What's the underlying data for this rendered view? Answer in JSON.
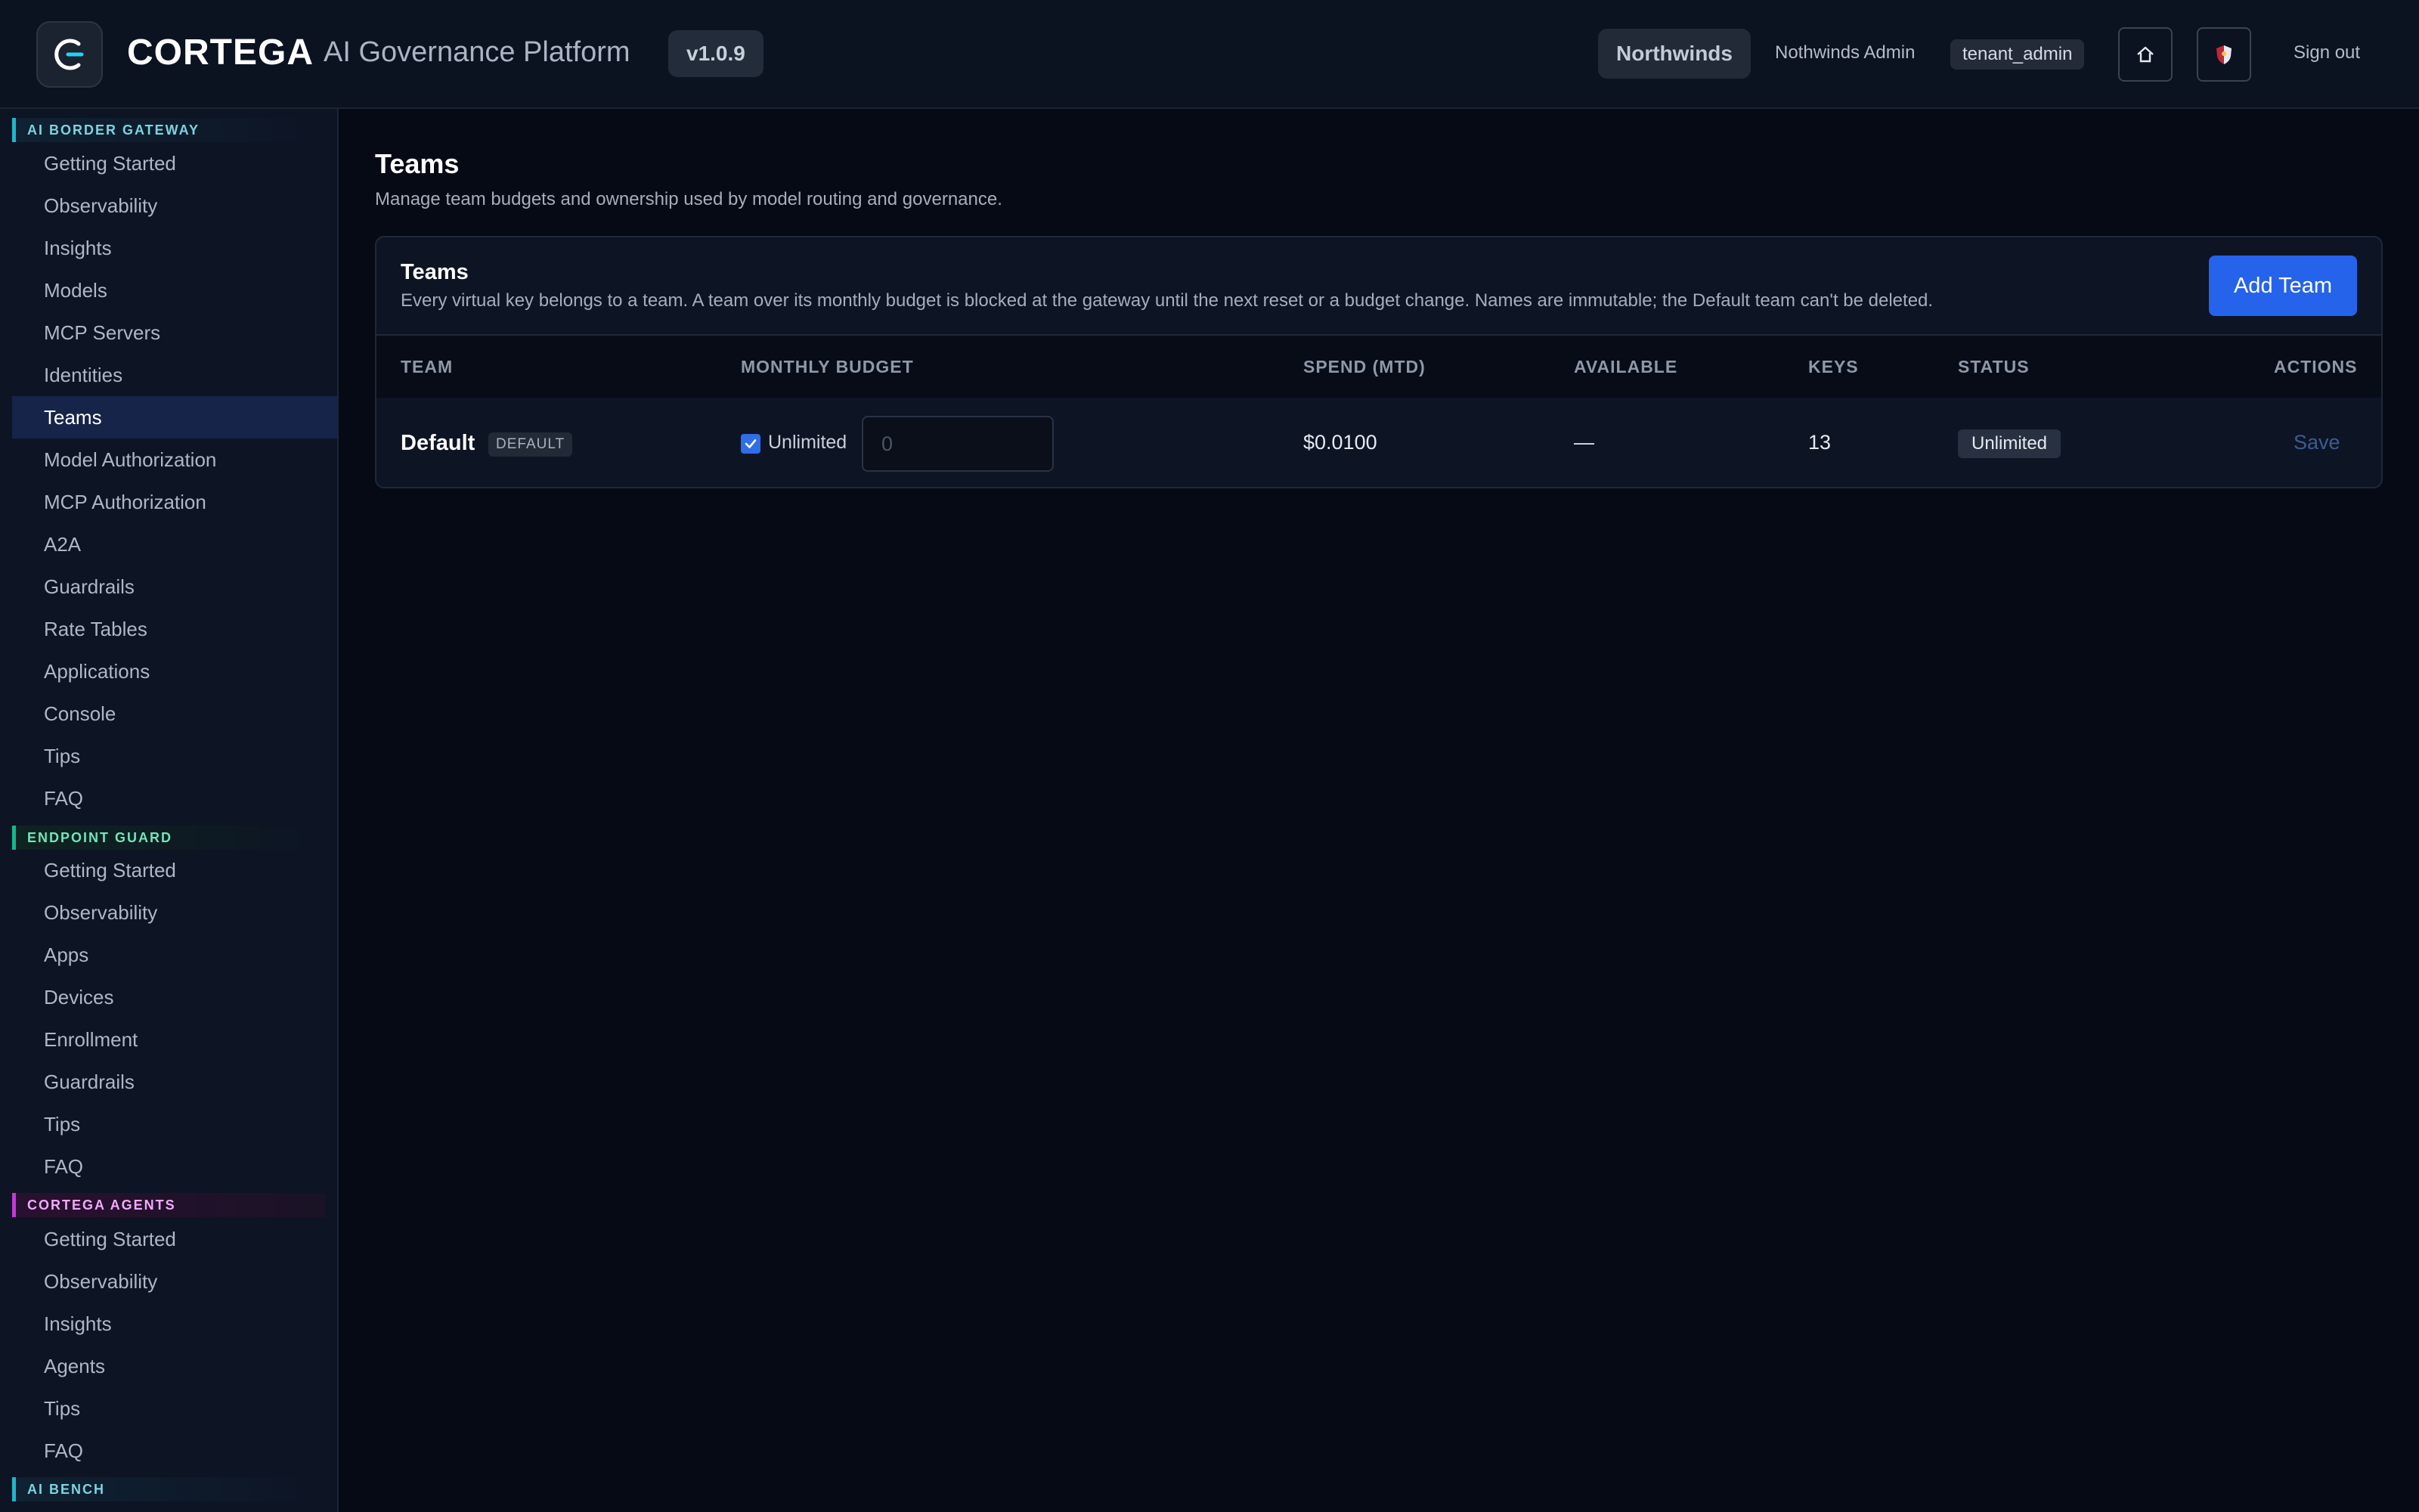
{
  "header": {
    "brand": "CORTEGA",
    "platform": "AI Governance Platform",
    "version": "v1.0.9",
    "tenant": "Northwinds",
    "user": "Nothwinds Admin",
    "role": "tenant_admin",
    "home_icon": "home-icon",
    "shield_icon": "shield-icon",
    "signout": "Sign out"
  },
  "sidebar": {
    "sections": [
      {
        "title": "AI BORDER GATEWAY",
        "items": [
          "Getting Started",
          "Observability",
          "Insights",
          "Models",
          "MCP Servers",
          "Identities",
          "Teams",
          "Model Authorization",
          "MCP Authorization",
          "A2A",
          "Guardrails",
          "Rate Tables",
          "Applications",
          "Console",
          "Tips",
          "FAQ"
        ]
      },
      {
        "title": "ENDPOINT GUARD",
        "items": [
          "Getting Started",
          "Observability",
          "Apps",
          "Devices",
          "Enrollment",
          "Guardrails",
          "Tips",
          "FAQ"
        ]
      },
      {
        "title": "CORTEGA AGENTS",
        "items": [
          "Getting Started",
          "Observability",
          "Insights",
          "Agents",
          "Tips",
          "FAQ"
        ]
      },
      {
        "title": "AI BENCH",
        "items": []
      }
    ],
    "active_item": "Teams"
  },
  "page": {
    "title": "Teams",
    "subtitle": "Manage team budgets and ownership used by model routing and governance."
  },
  "card": {
    "title": "Teams",
    "description": "Every virtual key belongs to a team. A team over its monthly budget is blocked at the gateway until the next reset or a budget change. Names are immutable; the Default team can't be deleted.",
    "add_button": "Add Team"
  },
  "table": {
    "columns": [
      "TEAM",
      "MONTHLY BUDGET",
      "SPEND (MTD)",
      "AVAILABLE",
      "KEYS",
      "STATUS",
      "ACTIONS"
    ],
    "rows": [
      {
        "team": "Default",
        "badge": "DEFAULT",
        "unlimited_checked": true,
        "unlimited_label": "Unlimited",
        "budget_placeholder": "0",
        "spend": "$0.0100",
        "available": "—",
        "keys": "13",
        "status": "Unlimited",
        "action": "Save"
      }
    ]
  },
  "colors": {
    "accent": "#2563eb",
    "gateway": "#22b5c8",
    "endpoint": "#14b88a",
    "agents": "#c13ad6"
  }
}
